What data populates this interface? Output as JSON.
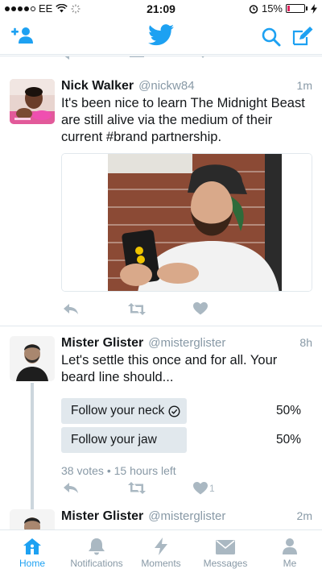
{
  "status_bar": {
    "carrier": "EE",
    "time": "21:09",
    "battery_percent": "15%",
    "battery_level": 0.15
  },
  "nav": {
    "brand_color": "#1DA1F2"
  },
  "tweets": [
    {
      "name": "Nick Walker",
      "handle": "@nickw84",
      "time": "1m",
      "text": "It's been nice to learn The Midnight Beast are still alive via the medium of their current #brand partnership."
    },
    {
      "name": "Mister Glister",
      "handle": "@misterglister",
      "time": "8h",
      "text": "Let's settle this once and for all. Your beard line should...",
      "poll": {
        "options": [
          {
            "label": "Follow your neck",
            "percent": "50%",
            "selected": true,
            "fraction": 0.5
          },
          {
            "label": "Follow your jaw",
            "percent": "50%",
            "selected": false,
            "fraction": 0.5
          }
        ],
        "meta": "38 votes • 15 hours left"
      },
      "like_count": "1"
    },
    {
      "name": "Mister Glister",
      "handle": "@misterglister",
      "time": "2m"
    }
  ],
  "tabs": [
    {
      "label": "Home",
      "icon": "home-icon",
      "active": true
    },
    {
      "label": "Notifications",
      "icon": "bell-icon",
      "active": false
    },
    {
      "label": "Moments",
      "icon": "lightning-icon",
      "active": false
    },
    {
      "label": "Messages",
      "icon": "envelope-icon",
      "active": false
    },
    {
      "label": "Me",
      "icon": "person-icon",
      "active": false
    }
  ]
}
